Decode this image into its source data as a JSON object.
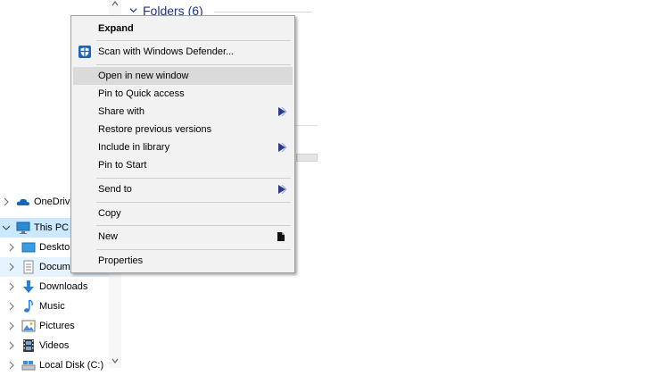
{
  "explorer": {
    "group_header": "Folders (6)",
    "nav": [
      {
        "label": "OneDrive"
      },
      {
        "label": "This PC"
      },
      {
        "label": "Desktop"
      },
      {
        "label": "Docum"
      },
      {
        "label": "Downloads"
      },
      {
        "label": "Music"
      },
      {
        "label": "Pictures"
      },
      {
        "label": "Videos"
      },
      {
        "label": "Local Disk (C:)"
      }
    ]
  },
  "context_menu": {
    "items": [
      {
        "label": "Expand"
      },
      {
        "label": "Scan with Windows Defender..."
      },
      {
        "label": "Open in new window"
      },
      {
        "label": "Pin to Quick access"
      },
      {
        "label": "Share with"
      },
      {
        "label": "Restore previous versions"
      },
      {
        "label": "Include in library"
      },
      {
        "label": "Pin to Start"
      },
      {
        "label": "Send to"
      },
      {
        "label": "Copy"
      },
      {
        "label": "New"
      },
      {
        "label": "Properties"
      }
    ],
    "highlighted": "Open in new window"
  },
  "colors": {
    "menu_bg": "#f2f2f2",
    "menu_highlight": "#dadada",
    "selected_bg": "#cce8ff",
    "header_blue": "#1e3287",
    "submenu_arrow": "#2b3a8a"
  },
  "icons": {
    "defender": "shield-icon",
    "share_arrow": "submenu-arrow-icon",
    "library_arrow": "submenu-arrow-icon",
    "sendto_arrow": "submenu-arrow-icon",
    "new_arrow": "submenu-arrow-icon"
  }
}
